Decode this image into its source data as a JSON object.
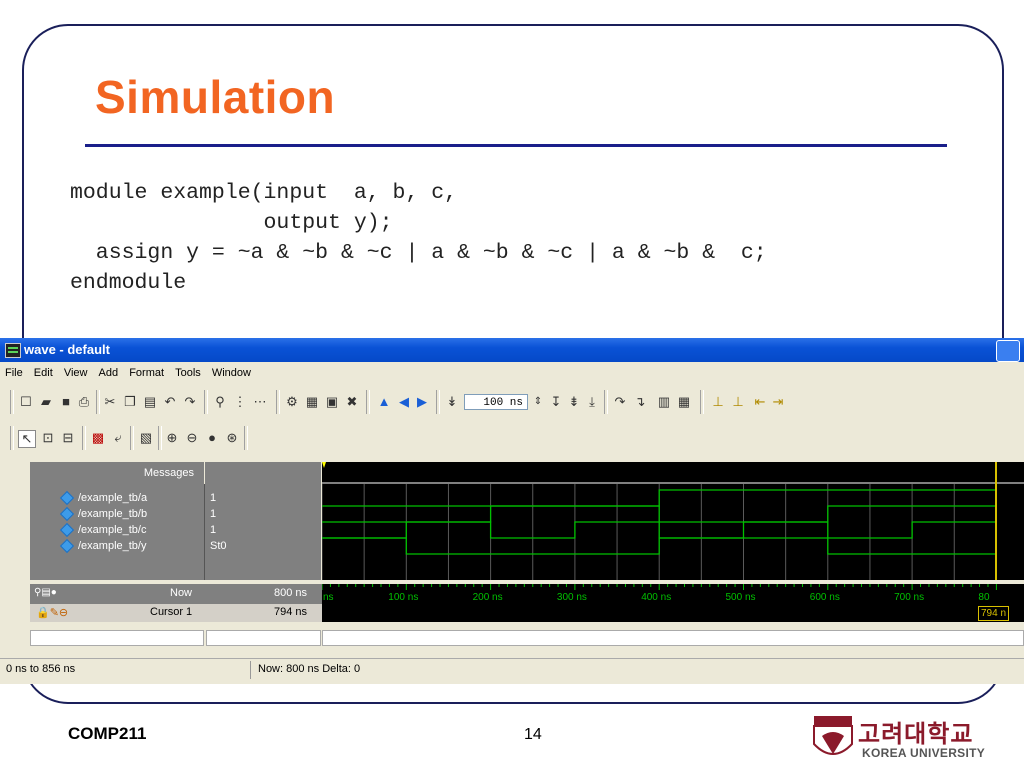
{
  "slide": {
    "title": "Simulation",
    "code_lines": [
      "module example(input  a, b, c,",
      "               output y);",
      "  assign y = ~a & ~b & ~c | a & ~b & ~c | a & ~b &  c;",
      "endmodule"
    ],
    "footer_course": "COMP211",
    "page_number": "14",
    "logo_korean": "고려대학교",
    "logo_english": "KOREA UNIVERSITY",
    "title_color": "#f26522",
    "accent_color": "#1a1f8a"
  },
  "window": {
    "title": "wave - default",
    "menu": [
      "File",
      "Edit",
      "View",
      "Add",
      "Format",
      "Tools",
      "Window"
    ],
    "run_length": "100 ns",
    "messages_header": "Messages",
    "signals": [
      {
        "name": "/example_tb/a",
        "value": "1"
      },
      {
        "name": "/example_tb/b",
        "value": "1"
      },
      {
        "name": "/example_tb/c",
        "value": "1"
      },
      {
        "name": "/example_tb/y",
        "value": "St0"
      }
    ],
    "now_label": "Now",
    "now_value": "800 ns",
    "cursor_label": "Cursor 1",
    "cursor_value": "794 ns",
    "cursor_tag": "794 n",
    "time_ticks": [
      "ns",
      "100 ns",
      "200 ns",
      "300 ns",
      "400 ns",
      "500 ns",
      "600 ns",
      "700 ns",
      "80"
    ],
    "status_range": "0 ns to 856 ns",
    "status_now": "Now: 800 ns  Delta: 0",
    "wave_color": "#00c000"
  }
}
